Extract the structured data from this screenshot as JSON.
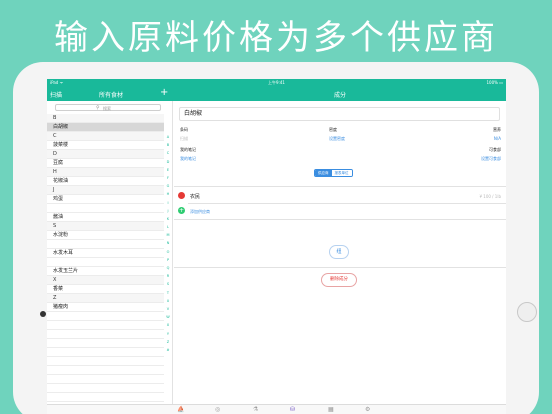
{
  "headline": "输入原料价格为多个供应商",
  "statusbar": {
    "carrier": "iPad ᯤ",
    "time": "上午9:41",
    "battery": "100% ▭"
  },
  "nav": {
    "scan": "扫描",
    "left_title": "所有食材",
    "add": "+",
    "right_title": "成分"
  },
  "search": {
    "icon": "search-icon",
    "placeholder": "搜索"
  },
  "list": [
    {
      "t": "B",
      "kind": "sec"
    },
    {
      "t": "白胡椒",
      "kind": "sel"
    },
    {
      "t": "C",
      "kind": "sec"
    },
    {
      "t": "菠菜楼",
      "kind": "item"
    },
    {
      "t": "D",
      "kind": "sec"
    },
    {
      "t": "豆腐",
      "kind": "item"
    },
    {
      "t": "H",
      "kind": "sec"
    },
    {
      "t": "花椒油",
      "kind": "item"
    },
    {
      "t": "J",
      "kind": "sec"
    },
    {
      "t": "鸡蛋",
      "kind": "item"
    },
    {
      "t": "",
      "kind": "empty"
    },
    {
      "t": "酱油",
      "kind": "item"
    },
    {
      "t": "S",
      "kind": "sec"
    },
    {
      "t": "水淀粉",
      "kind": "item"
    },
    {
      "t": "",
      "kind": "empty"
    },
    {
      "t": "水发木耳",
      "kind": "item"
    },
    {
      "t": "",
      "kind": "empty"
    },
    {
      "t": "水发玉兰片",
      "kind": "item"
    },
    {
      "t": "X",
      "kind": "sec"
    },
    {
      "t": "香菜",
      "kind": "item"
    },
    {
      "t": "Z",
      "kind": "sec"
    },
    {
      "t": "猪瘦肉",
      "kind": "item"
    },
    {
      "t": "",
      "kind": "empty"
    },
    {
      "t": "",
      "kind": "empty"
    },
    {
      "t": "",
      "kind": "empty"
    },
    {
      "t": "",
      "kind": "empty"
    },
    {
      "t": "",
      "kind": "empty"
    },
    {
      "t": "",
      "kind": "empty"
    },
    {
      "t": "",
      "kind": "empty"
    },
    {
      "t": "",
      "kind": "empty"
    },
    {
      "t": "",
      "kind": "empty"
    },
    {
      "t": "",
      "kind": "empty"
    }
  ],
  "index_letters": [
    "A",
    "B",
    "C",
    "D",
    "E",
    "F",
    "G",
    "H",
    "I",
    "J",
    "K",
    "L",
    "M",
    "N",
    "O",
    "P",
    "Q",
    "R",
    "S",
    "T",
    "U",
    "V",
    "W",
    "X",
    "Y",
    "Z",
    "#"
  ],
  "detail": {
    "name": "白胡椒",
    "labels": {
      "barcode": "条码",
      "density": "密度",
      "nutrition": "营养",
      "my_notes": "我的笔记",
      "edible": "可食部"
    },
    "values": {
      "barcode": "扫描",
      "density": "设置密度",
      "nutrition": "N/A",
      "my_notes": "我的笔记",
      "edible": "设置可食部"
    },
    "segment": [
      "供应商",
      "报表单位"
    ],
    "supplier": {
      "name": "农民",
      "price": "¥ 100 / 1lb"
    },
    "add_supplier": "添加供应商",
    "pill": "纽",
    "delete": "删除成分"
  },
  "tabs": [
    "⛵",
    "◎",
    "⚗",
    "⛁",
    "▦",
    "⚙"
  ],
  "colors": {
    "brand": "#19b99a",
    "accent": "#3a8de0",
    "danger": "#e53935",
    "background": "#6fd3bd"
  }
}
